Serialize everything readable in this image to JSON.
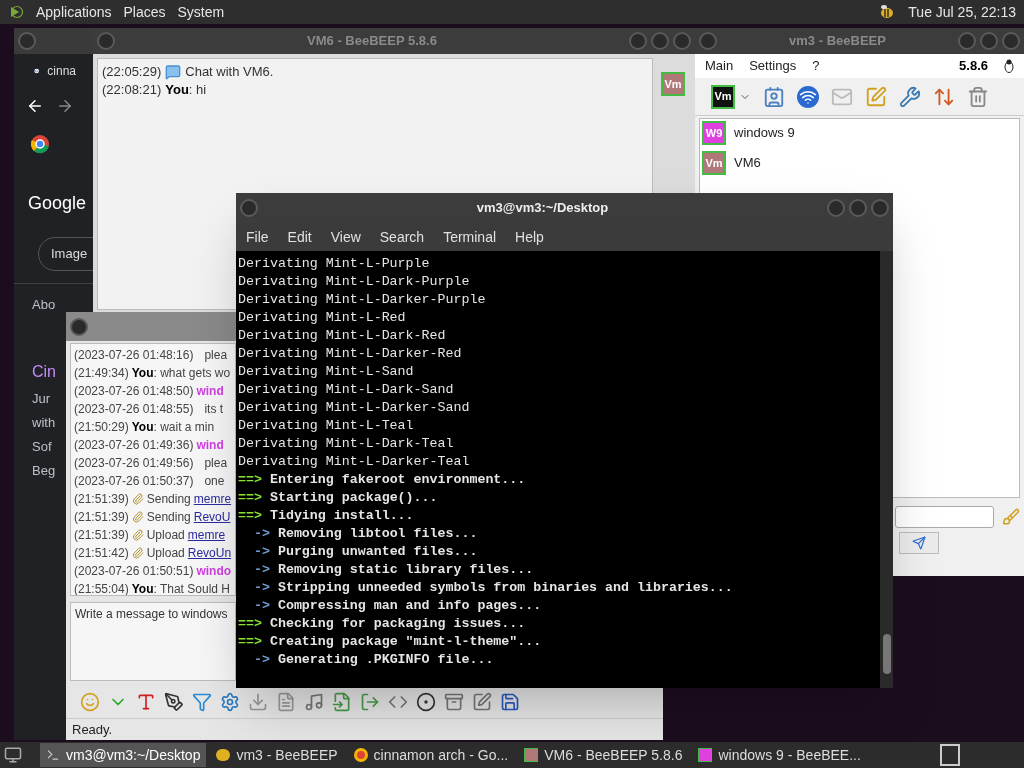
{
  "top_panel": {
    "menus": [
      "Applications",
      "Places",
      "System"
    ],
    "clock": "Tue Jul 25, 22:13"
  },
  "browser": {
    "tab": "cinna",
    "logo": "Google",
    "chip": "Image",
    "snippets": [
      {
        "text": "Abo",
        "kind": "plain"
      },
      {
        "text": "Cin",
        "kind": "title"
      },
      {
        "text": "Jur",
        "kind": "plain"
      },
      {
        "text": "with",
        "kind": "plain"
      },
      {
        "text": "Sof",
        "kind": "plain"
      },
      {
        "text": "Beg",
        "kind": "plain"
      }
    ]
  },
  "vm6_window": {
    "title": "VM6 - BeeBEEP 5.8.6",
    "avatar": {
      "text": "Vm",
      "color": "#b07878"
    },
    "messages": [
      {
        "time": "(22:05:29)",
        "kind": "system",
        "text": "Chat with VM6."
      },
      {
        "time": "(22:08:21)",
        "kind": "self",
        "who": "You",
        "text": ": hi"
      }
    ]
  },
  "vm3_window": {
    "title": "vm3 - BeeBEEP",
    "menus": [
      "Main",
      "Settings",
      "?"
    ],
    "version": "5.8.6",
    "own_avatar": {
      "text": "Vm",
      "color": "#111111"
    },
    "users": [
      {
        "name": "windows 9",
        "avatar": "W9",
        "color": "#e040e0"
      },
      {
        "name": "VM6",
        "avatar": "Vm",
        "color": "#b07878"
      }
    ]
  },
  "terminal": {
    "title": "vm3@vm3:~/Desktop",
    "menus": [
      "File",
      "Edit",
      "View",
      "Search",
      "Terminal",
      "Help"
    ],
    "lines": [
      {
        "kind": "plain",
        "text": "Derivating Mint-L-Purple"
      },
      {
        "kind": "plain",
        "text": "Derivating Mint-L-Dark-Purple"
      },
      {
        "kind": "plain",
        "text": "Derivating Mint-L-Darker-Purple"
      },
      {
        "kind": "plain",
        "text": "Derivating Mint-L-Red"
      },
      {
        "kind": "plain",
        "text": "Derivating Mint-L-Dark-Red"
      },
      {
        "kind": "plain",
        "text": "Derivating Mint-L-Darker-Red"
      },
      {
        "kind": "plain",
        "text": "Derivating Mint-L-Sand"
      },
      {
        "kind": "plain",
        "text": "Derivating Mint-L-Dark-Sand"
      },
      {
        "kind": "plain",
        "text": "Derivating Mint-L-Darker-Sand"
      },
      {
        "kind": "plain",
        "text": "Derivating Mint-L-Teal"
      },
      {
        "kind": "plain",
        "text": "Derivating Mint-L-Dark-Teal"
      },
      {
        "kind": "plain",
        "text": "Derivating Mint-L-Darker-Teal"
      },
      {
        "kind": "step",
        "prefix": "==>",
        "text": "Entering fakeroot environment..."
      },
      {
        "kind": "step",
        "prefix": "==>",
        "text": "Starting package()..."
      },
      {
        "kind": "step",
        "prefix": "==>",
        "text": "Tidying install..."
      },
      {
        "kind": "substep",
        "prefix": "->",
        "text": "Removing libtool files..."
      },
      {
        "kind": "substep",
        "prefix": "->",
        "text": "Purging unwanted files..."
      },
      {
        "kind": "substep",
        "prefix": "->",
        "text": "Removing static library files..."
      },
      {
        "kind": "substep",
        "prefix": "->",
        "text": "Stripping unneeded symbols from binaries and libraries..."
      },
      {
        "kind": "substep",
        "prefix": "->",
        "text": "Compressing man and info pages..."
      },
      {
        "kind": "step",
        "prefix": "==>",
        "text": "Checking for packaging issues..."
      },
      {
        "kind": "step",
        "prefix": "==>",
        "text": "Creating package \"mint-l-theme\"..."
      },
      {
        "kind": "substep",
        "prefix": "->",
        "text": "Generating .PKGINFO file..."
      }
    ]
  },
  "chat_window": {
    "messages": [
      {
        "time": "(2023-07-26 01:48:16)",
        "kind": "plain",
        "text": "plea"
      },
      {
        "time": "(21:49:34)",
        "kind": "self",
        "who": "You",
        "text": ": what gets wo"
      },
      {
        "time": "(2023-07-26 01:48:50)",
        "kind": "peer",
        "who": "wind"
      },
      {
        "time": "(2023-07-26 01:48:55)",
        "kind": "plain",
        "text": "its t"
      },
      {
        "time": "(21:50:29)",
        "kind": "self",
        "who": "You",
        "text": ": wait a min"
      },
      {
        "time": "(2023-07-26 01:49:36)",
        "kind": "peer",
        "who": "wind"
      },
      {
        "time": "(2023-07-26 01:49:56)",
        "kind": "plain",
        "text": "plea"
      },
      {
        "time": "(2023-07-26 01:50:37)",
        "kind": "plain",
        "text": "one"
      },
      {
        "time": "(21:51:39)",
        "kind": "file",
        "text": "Sending",
        "link": "memre"
      },
      {
        "time": "(21:51:39)",
        "kind": "file",
        "text": "Sending",
        "link": "RevoU"
      },
      {
        "time": "(21:51:39)",
        "kind": "file",
        "text": "Upload",
        "link": "memre"
      },
      {
        "time": "(21:51:42)",
        "kind": "file",
        "text": "Upload",
        "link": "RevoUn"
      },
      {
        "time": "(2023-07-26 01:50:51)",
        "kind": "peer",
        "who": "windo"
      },
      {
        "time": "(21:55:04)",
        "kind": "self",
        "who": "You",
        "text": ": That Sould H"
      }
    ],
    "input": {
      "placeholder": "Write a message to windows"
    },
    "status": "Ready."
  },
  "taskbar": {
    "items": [
      {
        "label": "vm3@vm3:~/Desktop",
        "kind": "terminal",
        "selected": true
      },
      {
        "label": "vm3 - BeeBEEP",
        "kind": "bee",
        "selected": false
      },
      {
        "label": "cinnamon arch - Go...",
        "kind": "chrome",
        "selected": false
      },
      {
        "label": "VM6 - BeeBEEP 5.8.6",
        "kind": "vm",
        "selected": false
      },
      {
        "label": "windows 9 - BeeBEE...",
        "kind": "w9",
        "selected": false
      }
    ]
  }
}
